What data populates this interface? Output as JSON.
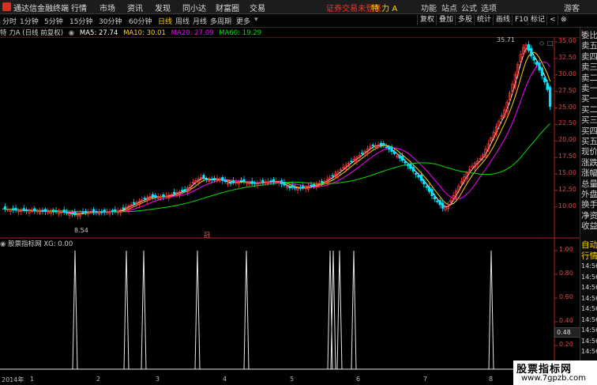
{
  "titlebar": {
    "app_title": "通达信金融终端",
    "menu": [
      "行情",
      "市场",
      "资讯",
      "发现",
      "同小达",
      "财富圈",
      "交易"
    ],
    "login_status": "证券交易未登录",
    "stock_name": "特 力 A",
    "window_buttons": [
      "功能",
      "站点",
      "公式",
      "选项",
      "游客"
    ]
  },
  "toolbar": {
    "periods": [
      "分时",
      "1分钟",
      "5分钟",
      "15分钟",
      "30分钟",
      "60分钟",
      "日线",
      "周线",
      "月线",
      "多周期",
      "更多"
    ],
    "active_period": "日线",
    "right_tools": [
      "复权",
      "叠加",
      "多股",
      "统计",
      "画线",
      "F10",
      "标记",
      "<",
      "⊗"
    ]
  },
  "ma_line": {
    "stock_label": "特 力A (日线 前复权)",
    "ma5": "MA5: 27.74",
    "ma10": "MA10: 30.01",
    "ma20": "MA20: 27.09",
    "ma60": "MA60: 19.29"
  },
  "price_axis": [
    "35.00",
    "32.50",
    "30.00",
    "27.50",
    "25.00",
    "22.50",
    "20.00",
    "17.50",
    "15.00",
    "12.50",
    "10.00"
  ],
  "annotations": {
    "high": "35.71",
    "low": "8.54",
    "ex_rights": "冠"
  },
  "indicator": {
    "header": "股票指标网  XG: 0.00",
    "axis": [
      "1.00",
      "0.80",
      "0.60",
      "0.40",
      "0.20"
    ],
    "cursor_value": "0.48"
  },
  "time_axis": [
    "2014年",
    "1",
    "2",
    "3",
    "4",
    "5",
    "6",
    "7",
    "8"
  ],
  "right_panel": [
    "委比",
    "卖五",
    "卖四",
    "卖三",
    "卖二",
    "卖一",
    "买一",
    "买二",
    "买三",
    "买四",
    "买五",
    "现价",
    "涨跌",
    "涨幅",
    "总量",
    "外盘",
    "换手",
    "净资",
    "收益"
  ],
  "right_panel_lower": [
    "自动",
    "行情",
    "14:56",
    "14:56",
    "14:56",
    "14:56",
    "14:56",
    "14:56",
    "14:56",
    "14:56",
    "14:56"
  ],
  "watermark": {
    "title": "股票指标网",
    "url": "www.7gpzb.com"
  },
  "colors": {
    "up": "#ff3c3c",
    "down": "#00e5ff",
    "ma5": "#ffffff",
    "ma10": "#ffd200",
    "ma20": "#ff00ff",
    "ma60": "#00e000",
    "axis": "#b02020"
  },
  "chart_data": {
    "type": "line",
    "indicator_spikes_x": [
      1,
      55,
      70,
      130,
      210,
      348,
      352,
      360,
      380,
      502
    ],
    "price_series_note": ""
  }
}
